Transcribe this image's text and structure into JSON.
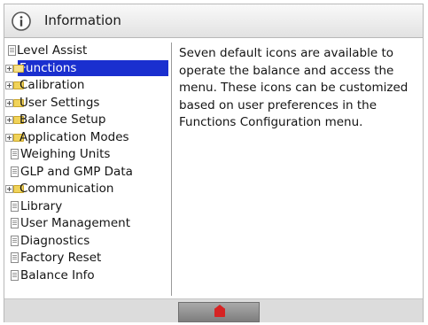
{
  "header": {
    "title": "Information",
    "icon": "info-icon"
  },
  "tree": {
    "items": [
      {
        "label": "Level Assist",
        "type": "doc"
      },
      {
        "label": "Functions",
        "type": "folder",
        "selected": true
      },
      {
        "label": "Calibration",
        "type": "folder"
      },
      {
        "label": "User Settings",
        "type": "folder"
      },
      {
        "label": "Balance Setup",
        "type": "folder"
      },
      {
        "label": "Application Modes",
        "type": "folder"
      },
      {
        "label": "Weighing Units",
        "type": "doc"
      },
      {
        "label": "GLP and GMP Data",
        "type": "doc"
      },
      {
        "label": "Communication",
        "type": "folder"
      },
      {
        "label": "Library",
        "type": "doc"
      },
      {
        "label": "User Management",
        "type": "doc"
      },
      {
        "label": "Diagnostics",
        "type": "doc"
      },
      {
        "label": "Factory Reset",
        "type": "doc"
      },
      {
        "label": "Balance Info",
        "type": "doc"
      }
    ]
  },
  "description": {
    "lines": [
      "Seven default icons are available to",
      "operate the balance and access the",
      "menu. These icons can be customized",
      "based on user preferences in the",
      "Functions Configuration menu."
    ]
  },
  "footer": {
    "home_icon": "home-icon"
  },
  "colors": {
    "selection": "#1a2fcf",
    "home_icon": "#d62323"
  }
}
